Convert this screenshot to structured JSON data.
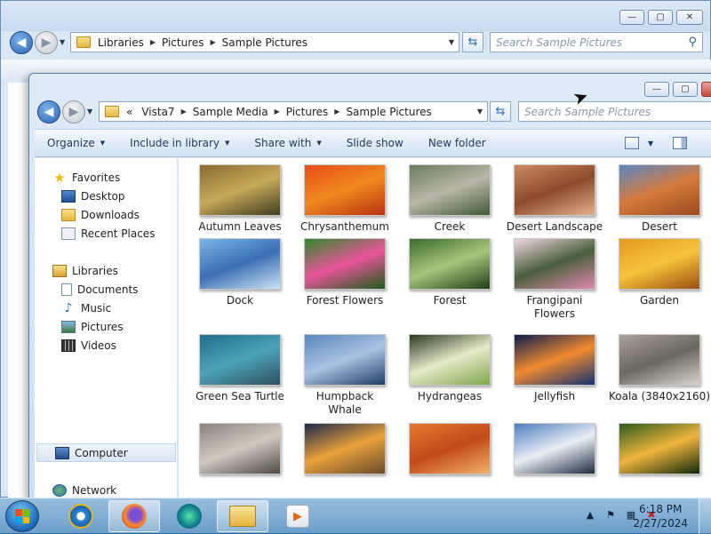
{
  "back_window": {
    "address": [
      "Libraries",
      "Pictures",
      "Sample Pictures"
    ],
    "search_placeholder": "Search Sample Pictures",
    "commands": [
      "Organize",
      "Share with",
      "Slide show",
      "New folder"
    ]
  },
  "front_window": {
    "address": [
      "«",
      "Vista7",
      "Sample Media",
      "Pictures",
      "Sample Pictures"
    ],
    "search_placeholder": "Search Sample Pictures",
    "commands": [
      {
        "label": "Organize",
        "dropdown": true
      },
      {
        "label": "Include in library",
        "dropdown": true
      },
      {
        "label": "Share with",
        "dropdown": true
      },
      {
        "label": "Slide show",
        "dropdown": false
      },
      {
        "label": "New folder",
        "dropdown": false
      }
    ],
    "nav": {
      "favorites": {
        "label": "Favorites",
        "items": [
          "Desktop",
          "Downloads",
          "Recent Places"
        ]
      },
      "libraries": {
        "label": "Libraries",
        "items": [
          "Documents",
          "Music",
          "Pictures",
          "Videos"
        ]
      },
      "computer": "Computer",
      "network": "Network"
    },
    "thumbnails": [
      {
        "name": "Autumn Leaves",
        "colors": [
          "#8a6a2e",
          "#c7a95a",
          "#3d3c1e"
        ]
      },
      {
        "name": "Chrysanthemum",
        "colors": [
          "#e74c1a",
          "#f08a1f",
          "#b8300f"
        ]
      },
      {
        "name": "Creek",
        "colors": [
          "#6a7b5b",
          "#b9b7a9",
          "#3f5a33"
        ]
      },
      {
        "name": "Desert Landscape",
        "colors": [
          "#c98b62",
          "#8d4b2a",
          "#e6b08c"
        ]
      },
      {
        "name": "Desert",
        "colors": [
          "#5a87c2",
          "#d47a3c",
          "#9b4a1e"
        ]
      },
      {
        "name": "Dock",
        "colors": [
          "#7ab6e8",
          "#3a6fb2",
          "#c9e2f5"
        ]
      },
      {
        "name": "Forest Flowers",
        "colors": [
          "#2f8a2a",
          "#e8559b",
          "#1d5c1a"
        ]
      },
      {
        "name": "Forest",
        "colors": [
          "#3b6b2c",
          "#a6c77b",
          "#1f3d18"
        ]
      },
      {
        "name": "Frangipani\nFlowers",
        "colors": [
          "#f1d6e3",
          "#49603a",
          "#e089b1"
        ]
      },
      {
        "name": "Garden",
        "colors": [
          "#e39a1d",
          "#f6c43b",
          "#9a4e0e"
        ]
      },
      {
        "name": "Green Sea Turtle",
        "colors": [
          "#1f6d8e",
          "#4da3b8",
          "#2d4f5e"
        ]
      },
      {
        "name": "Humpback\nWhale",
        "colors": [
          "#5a86bd",
          "#a9c3e2",
          "#1d3e66"
        ]
      },
      {
        "name": "Hydrangeas",
        "colors": [
          "#2b3a1c",
          "#e6e9c9",
          "#7fa64c"
        ]
      },
      {
        "name": "Jellyfish",
        "colors": [
          "#0b1c4e",
          "#f08b2e",
          "#143072"
        ]
      },
      {
        "name": "Koala (3840x2160)",
        "colors": [
          "#a9a29a",
          "#6b6660",
          "#d9d4cc"
        ]
      },
      {
        "name": "",
        "colors": [
          "#8a837b",
          "#cfc9c0",
          "#4f4a44"
        ]
      },
      {
        "name": "",
        "colors": [
          "#1c2a4a",
          "#e9a13b",
          "#6c4a2c"
        ]
      },
      {
        "name": "",
        "colors": [
          "#e57a30",
          "#c24a19",
          "#f2b06b"
        ]
      },
      {
        "name": "",
        "colors": [
          "#4f7dbf",
          "#e9eef5",
          "#1d2c40"
        ]
      },
      {
        "name": "",
        "colors": [
          "#2b5a1f",
          "#f0b53c",
          "#12280d"
        ]
      }
    ]
  },
  "taskbar": {
    "time": "6:18 PM",
    "date": "2/27/2024",
    "apps": [
      "internet-explorer",
      "firefox",
      "edge",
      "windows-explorer",
      "media-player"
    ]
  }
}
